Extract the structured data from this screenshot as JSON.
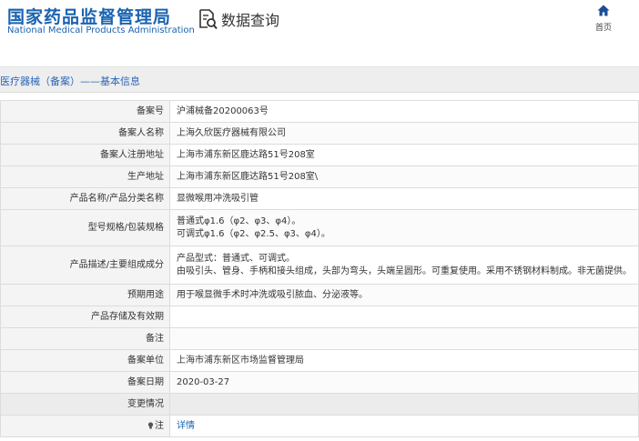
{
  "header": {
    "logo_cn": "国家药品监督管理局",
    "logo_en": "National Medical Products Administration",
    "query_label": "数据查询",
    "home_label": "首页"
  },
  "section": {
    "title": "医疗器械（备案）——基本信息"
  },
  "rows": [
    {
      "label": "备案号",
      "lines": [
        "沪浦械备20200063号"
      ]
    },
    {
      "label": "备案人名称",
      "lines": [
        "上海久欣医疗器械有限公司"
      ]
    },
    {
      "label": "备案人注册地址",
      "lines": [
        "上海市浦东新区鹿达路51号208室"
      ]
    },
    {
      "label": "生产地址",
      "lines": [
        "上海市浦东新区鹿达路51号208室\\"
      ]
    },
    {
      "label": "产品名称/产品分类名称",
      "lines": [
        "显微喉用冲洗吸引管"
      ]
    },
    {
      "label": "型号规格/包装规格",
      "lines": [
        "普通式φ1.6（φ2、φ3、φ4）。",
        "可调式φ1.6（φ2、φ2.5、φ3、φ4）。"
      ]
    },
    {
      "label": "产品描述/主要组成成分",
      "lines": [
        "产品型式：普通式、可调式。",
        "由吸引头、管身、手柄和接头组成，头部为弯头，头端呈圆形。可重复使用。采用不锈钢材料制成。非无菌提供。"
      ]
    },
    {
      "label": "预期用途",
      "lines": [
        "用于喉显微手术时冲洗或吸引脓血、分泌液等。"
      ]
    },
    {
      "label": "产品存储及有效期",
      "lines": [
        ""
      ]
    },
    {
      "label": "备注",
      "lines": [
        ""
      ]
    },
    {
      "label": "备案单位",
      "lines": [
        "上海市浦东新区市场监督管理局"
      ]
    },
    {
      "label": "备案日期",
      "lines": [
        "2020-03-27"
      ]
    },
    {
      "label": "变更情况",
      "lines": [
        ""
      ]
    },
    {
      "label": "注",
      "lines": [
        "详情"
      ]
    }
  ],
  "colors": {
    "brand_blue": "#1a63b0",
    "section_bg": "#eeeeee",
    "label_bg": "#f4f4f4",
    "border": "#dcdcdc"
  }
}
